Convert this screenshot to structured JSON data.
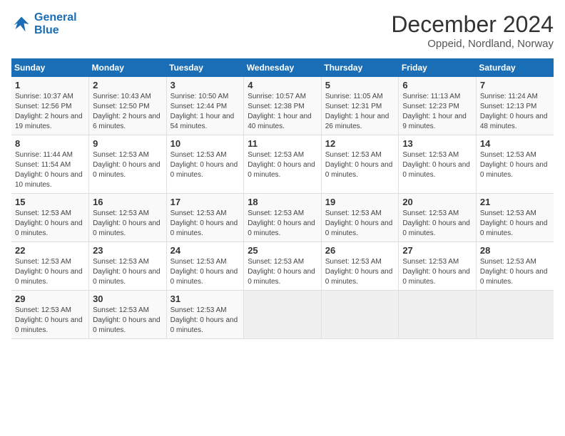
{
  "logo": {
    "line1": "General",
    "line2": "Blue"
  },
  "title": "December 2024",
  "location": "Oppeid, Nordland, Norway",
  "days_header": [
    "Sunday",
    "Monday",
    "Tuesday",
    "Wednesday",
    "Thursday",
    "Friday",
    "Saturday"
  ],
  "weeks": [
    [
      {
        "day": "1",
        "info": "Sunrise: 10:37 AM\nSunset: 12:56 PM\nDaylight: 2 hours and 19 minutes."
      },
      {
        "day": "2",
        "info": "Sunrise: 10:43 AM\nSunset: 12:50 PM\nDaylight: 2 hours and 6 minutes."
      },
      {
        "day": "3",
        "info": "Sunrise: 10:50 AM\nSunset: 12:44 PM\nDaylight: 1 hour and 54 minutes."
      },
      {
        "day": "4",
        "info": "Sunrise: 10:57 AM\nSunset: 12:38 PM\nDaylight: 1 hour and 40 minutes."
      },
      {
        "day": "5",
        "info": "Sunrise: 11:05 AM\nSunset: 12:31 PM\nDaylight: 1 hour and 26 minutes."
      },
      {
        "day": "6",
        "info": "Sunrise: 11:13 AM\nSunset: 12:23 PM\nDaylight: 1 hour and 9 minutes."
      },
      {
        "day": "7",
        "info": "Sunrise: 11:24 AM\nSunset: 12:13 PM\nDaylight: 0 hours and 48 minutes."
      }
    ],
    [
      {
        "day": "8",
        "info": "Sunrise: 11:44 AM\nSunset: 11:54 AM\nDaylight: 0 hours and 10 minutes."
      },
      {
        "day": "9",
        "info": "Sunset: 12:53 AM\nDaylight: 0 hours and 0 minutes."
      },
      {
        "day": "10",
        "info": "Sunset: 12:53 AM\nDaylight: 0 hours and 0 minutes."
      },
      {
        "day": "11",
        "info": "Sunset: 12:53 AM\nDaylight: 0 hours and 0 minutes."
      },
      {
        "day": "12",
        "info": "Sunset: 12:53 AM\nDaylight: 0 hours and 0 minutes."
      },
      {
        "day": "13",
        "info": "Sunset: 12:53 AM\nDaylight: 0 hours and 0 minutes."
      },
      {
        "day": "14",
        "info": "Sunset: 12:53 AM\nDaylight: 0 hours and 0 minutes."
      }
    ],
    [
      {
        "day": "15",
        "info": "Sunset: 12:53 AM\nDaylight: 0 hours and 0 minutes."
      },
      {
        "day": "16",
        "info": "Sunset: 12:53 AM\nDaylight: 0 hours and 0 minutes."
      },
      {
        "day": "17",
        "info": "Sunset: 12:53 AM\nDaylight: 0 hours and 0 minutes."
      },
      {
        "day": "18",
        "info": "Sunset: 12:53 AM\nDaylight: 0 hours and 0 minutes."
      },
      {
        "day": "19",
        "info": "Sunset: 12:53 AM\nDaylight: 0 hours and 0 minutes."
      },
      {
        "day": "20",
        "info": "Sunset: 12:53 AM\nDaylight: 0 hours and 0 minutes."
      },
      {
        "day": "21",
        "info": "Sunset: 12:53 AM\nDaylight: 0 hours and 0 minutes."
      }
    ],
    [
      {
        "day": "22",
        "info": "Sunset: 12:53 AM\nDaylight: 0 hours and 0 minutes."
      },
      {
        "day": "23",
        "info": "Sunset: 12:53 AM\nDaylight: 0 hours and 0 minutes."
      },
      {
        "day": "24",
        "info": "Sunset: 12:53 AM\nDaylight: 0 hours and 0 minutes."
      },
      {
        "day": "25",
        "info": "Sunset: 12:53 AM\nDaylight: 0 hours and 0 minutes."
      },
      {
        "day": "26",
        "info": "Sunset: 12:53 AM\nDaylight: 0 hours and 0 minutes."
      },
      {
        "day": "27",
        "info": "Sunset: 12:53 AM\nDaylight: 0 hours and 0 minutes."
      },
      {
        "day": "28",
        "info": "Sunset: 12:53 AM\nDaylight: 0 hours and 0 minutes."
      }
    ],
    [
      {
        "day": "29",
        "info": "Sunset: 12:53 AM\nDaylight: 0 hours and 0 minutes."
      },
      {
        "day": "30",
        "info": "Sunset: 12:53 AM\nDaylight: 0 hours and 0 minutes."
      },
      {
        "day": "31",
        "info": "Sunset: 12:53 AM\nDaylight: 0 hours and 0 minutes."
      },
      {
        "day": "",
        "info": ""
      },
      {
        "day": "",
        "info": ""
      },
      {
        "day": "",
        "info": ""
      },
      {
        "day": "",
        "info": ""
      }
    ]
  ]
}
